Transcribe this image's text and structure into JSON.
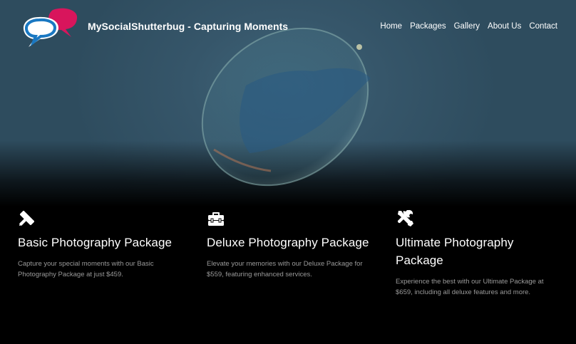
{
  "brand": {
    "title": "MySocialShutterbug - Capturing Moments"
  },
  "nav": {
    "items": [
      {
        "label": "Home"
      },
      {
        "label": "Packages"
      },
      {
        "label": "Gallery"
      },
      {
        "label": "About Us"
      },
      {
        "label": "Contact"
      }
    ]
  },
  "colors": {
    "logo_blue": "#1a78c2",
    "logo_pink": "#d8155c",
    "hero_teal": "#36566a",
    "muted_text": "#9a9a9a"
  },
  "features": [
    {
      "icon": "pencil-ruler-icon",
      "title": "Basic Photography Package",
      "description": "Capture your special moments with our Basic Photography Package at just $459."
    },
    {
      "icon": "toolbox-icon",
      "title": "Deluxe Photography Package",
      "description": "Elevate your memories with our Deluxe Package for $559, featuring enhanced services."
    },
    {
      "icon": "tools-icon",
      "title": "Ultimate Photography Package",
      "description": "Experience the best with our Ultimate Package at $659, including all deluxe features and more."
    }
  ]
}
